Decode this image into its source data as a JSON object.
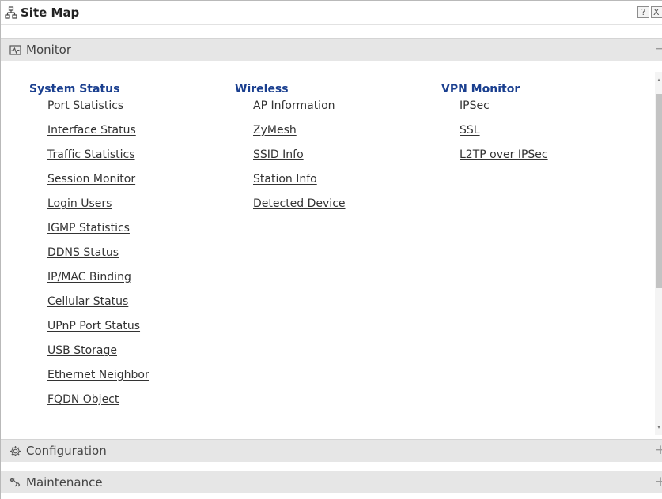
{
  "window": {
    "title": "Site Map",
    "help_label": "?",
    "close_label": "X"
  },
  "sections": {
    "monitor": {
      "label": "Monitor",
      "toggle": "−"
    },
    "configuration": {
      "label": "Configuration",
      "toggle": "+"
    },
    "maintenance": {
      "label": "Maintenance",
      "toggle": "+"
    }
  },
  "monitor": {
    "columns": [
      {
        "title": "System Status",
        "links": [
          "Port Statistics",
          "Interface Status",
          "Traffic Statistics",
          "Session Monitor",
          "Login Users",
          "IGMP Statistics",
          "DDNS Status",
          "IP/MAC Binding",
          "Cellular Status",
          "UPnP Port Status",
          "USB Storage",
          "Ethernet Neighbor",
          "FQDN Object"
        ]
      },
      {
        "title": "Wireless",
        "links": [
          "AP Information",
          "ZyMesh",
          "SSID Info",
          "Station Info",
          "Detected Device"
        ]
      },
      {
        "title": "VPN Monitor",
        "links": [
          "IPSec",
          "SSL",
          "L2TP over IPSec"
        ]
      }
    ]
  },
  "colors": {
    "column_title": "#1a3f8f",
    "section_header_bg": "#e6e6e6",
    "link_text": "#333333"
  },
  "icons": {
    "title": "sitemap-icon",
    "monitor": "monitor-icon",
    "configuration": "gear-icon",
    "maintenance": "wrench-icon"
  }
}
